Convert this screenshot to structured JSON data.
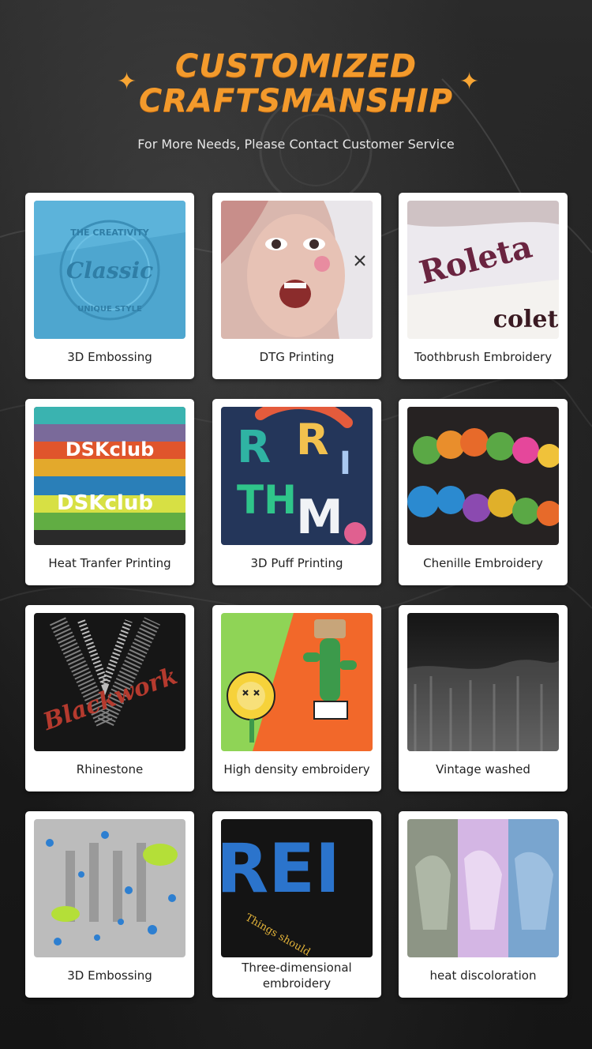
{
  "header": {
    "title_line1": "CUSTOMIZED",
    "title_line2": "CRAFTSMANSHIP",
    "subtitle": "For More Needs, Please Contact Customer Service",
    "sparkle_icon": "sparkle-icon"
  },
  "colors": {
    "accent": "#f39a2c",
    "background": "#1a1a1a",
    "card": "#ffffff",
    "label_text": "#222222"
  },
  "techniques": [
    {
      "label": "3D Embossing"
    },
    {
      "label": "DTG Printing"
    },
    {
      "label": "Toothbrush Embroidery"
    },
    {
      "label": "Heat Tranfer Printing"
    },
    {
      "label": "3D Puff Printing"
    },
    {
      "label": "Chenille Embroidery"
    },
    {
      "label": "Rhinestone"
    },
    {
      "label": "High density embroidery"
    },
    {
      "label": "Vintage washed"
    },
    {
      "label": "3D Embossing"
    },
    {
      "label": "Three-dimensional embroidery"
    },
    {
      "label": "heat discoloration"
    }
  ],
  "thumb_text": {
    "embossing_arc": "THE CREATIVITY",
    "embossing_script": "Classic",
    "embossing_bottom": "UNIQUE STYLE",
    "toothbrush_word": "Roleta",
    "heat_transfer_word": "DSKclub",
    "rhinestone_script": "Blackwork",
    "three_d_caption": "Things should"
  }
}
